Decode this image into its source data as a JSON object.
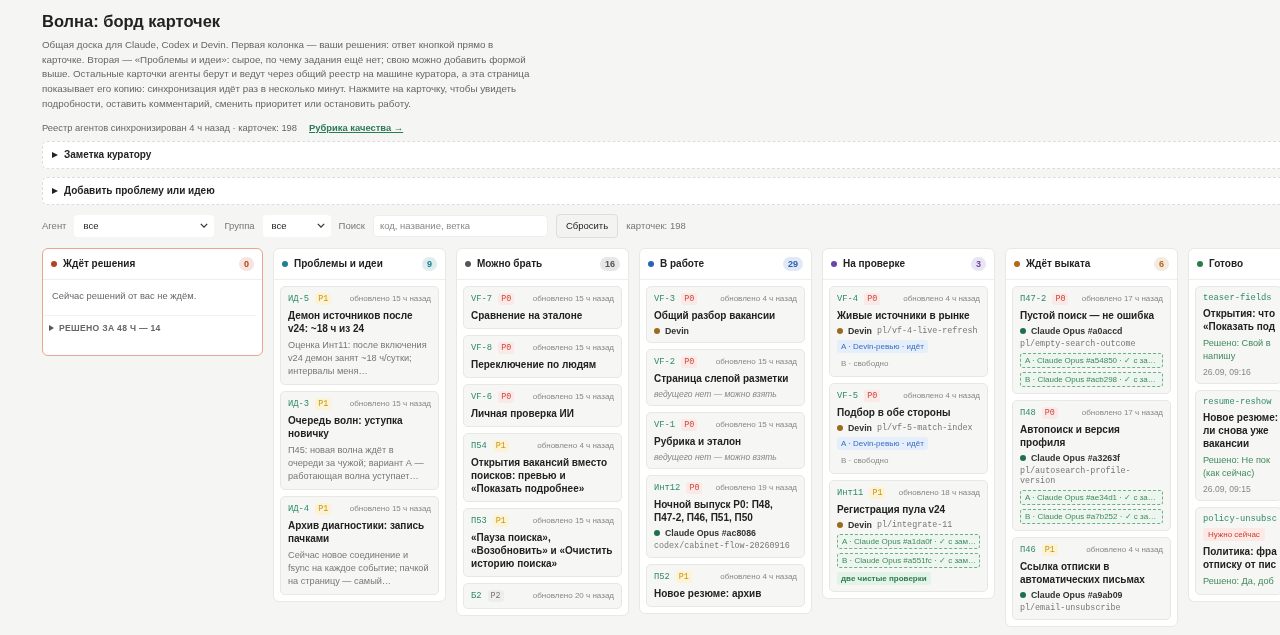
{
  "title": "Волна: борд карточек",
  "intro": "Общая доска для Claude, Codex и Devin. Первая колонка — ваши решения: ответ кнопкой прямо в карточке. Вторая — «Проблемы и идеи»: сырое, по чему задания ещё нет; свою можно добавить формой выше. Остальные карточки агенты берут и ведут через общий реестр на машине куратора, а эта страница показывает его копию: синхронизация идёт раз в несколько минут. Нажмите на карточку, чтобы увидеть подробности, оставить комментарий, сменить приоритет или остановить работу.",
  "meta": {
    "text": "Реестр агентов синхронизирован 4 ч назад · карточек: 198",
    "link": "Рубрика качества →"
  },
  "sections": [
    {
      "label": "Заметка куратору",
      "expanded": false
    },
    {
      "label": "Добавить проблему или идею",
      "expanded": false
    }
  ],
  "filters": {
    "agent_label": "Агент",
    "agent_value": "все",
    "group_label": "Группа",
    "group_value": "все",
    "search_label": "Поиск",
    "search_placeholder": "код, название, ветка",
    "reset": "Сбросить",
    "count": "карточек: 198"
  },
  "columns": [
    {
      "kind": "decisions",
      "title": "Ждёт решения",
      "color": "#b8401e",
      "count": "0",
      "empty": "Сейчас решений от вас не ждём.",
      "resolved": {
        "label": "РЕШЕНО ЗА 48 Ч — 14",
        "expanded": false
      }
    },
    {
      "kind": "board",
      "title": "Проблемы и идеи",
      "color": "#1f7f8e",
      "count": "9",
      "cards": [
        {
          "code": "ИД-5",
          "priority": {
            "label": "P1",
            "kind": "high"
          },
          "updated": "обновлено 15 ч назад",
          "title": "Демон источников после v24: ~18 ч из 24",
          "desc": "Оценка Инт11: после включения v24 демон занят ~18 ч/сутки; интервалы меня…"
        },
        {
          "code": "ИД-3",
          "priority": {
            "label": "P1",
            "kind": "high"
          },
          "updated": "обновлено 15 ч назад",
          "title": "Очередь волн: уступка новичку",
          "desc": "П45: новая волна ждёт в очереди за чужой; вариант А — работающая волна уступает…"
        },
        {
          "code": "ИД-4",
          "priority": {
            "label": "P1",
            "kind": "high"
          },
          "updated": "обновлено 15 ч назад",
          "title": "Архив диагностики: запись пачками",
          "desc": "Сейчас новое соединение и fsync на каждое событие; пачкой на страницу — самый…"
        }
      ]
    },
    {
      "kind": "board",
      "title": "Можно брать",
      "color": "#555555",
      "count": "16",
      "cards": [
        {
          "code": "VF-7",
          "priority": {
            "label": "P0",
            "kind": "urgent"
          },
          "updated": "обновлено 15 ч назад",
          "title": "Сравнение на эталоне"
        },
        {
          "code": "VF-8",
          "priority": {
            "label": "P0",
            "kind": "urgent"
          },
          "updated": "обновлено 15 ч назад",
          "title": "Переключение по людям"
        },
        {
          "code": "VF-6",
          "priority": {
            "label": "P0",
            "kind": "urgent"
          },
          "updated": "обновлено 15 ч назад",
          "title": "Личная проверка ИИ"
        },
        {
          "code": "П54",
          "priority": {
            "label": "P1",
            "kind": "high"
          },
          "updated": "обновлено 4 ч назад",
          "title": "Открытия вакансий вместо поисков: превью и «Показать подробнее»"
        },
        {
          "code": "П53",
          "priority": {
            "label": "P1",
            "kind": "high"
          },
          "updated": "обновлено 15 ч назад",
          "title": "«Пауза поиска», «Возобновить» и «Очистить историю поиска»"
        },
        {
          "code": "Б2",
          "priority": {
            "label": "P2",
            "kind": "low"
          },
          "updated": "обновлено 20 ч назад"
        }
      ]
    },
    {
      "kind": "board",
      "title": "В работе",
      "color": "#2a62b8",
      "count": "29",
      "cards": [
        {
          "code": "VF-3",
          "priority": {
            "label": "P0",
            "kind": "urgent"
          },
          "updated": "обновлено 4 ч назад",
          "title": "Общий разбор вакансии",
          "agent": {
            "name": "Devin",
            "color": "#9a6a1e"
          }
        },
        {
          "code": "VF-2",
          "priority": {
            "label": "P0",
            "kind": "urgent"
          },
          "updated": "обновлено 15 ч назад",
          "title": "Страница слепой разметки",
          "note": "ведущего нет — можно взять"
        },
        {
          "code": "VF-1",
          "priority": {
            "label": "P0",
            "kind": "urgent"
          },
          "updated": "обновлено 15 ч назад",
          "title": "Рубрика и эталон",
          "note": "ведущего нет — можно взять"
        },
        {
          "code": "Инт12",
          "priority": {
            "label": "P0",
            "kind": "urgent"
          },
          "updated": "обновлено 19 ч назад",
          "title": "Ночной выпуск P0: П48, П47-2, П46, П51, П50",
          "agent": {
            "name": "Claude Opus #ac8086",
            "color": "#1f6f4f",
            "branch": "codex/cabinet-flow-20260916"
          }
        },
        {
          "code": "П52",
          "priority": {
            "label": "P1",
            "kind": "high"
          },
          "updated": "обновлено 4 ч назад",
          "title": "Новое резюме: архив"
        }
      ]
    },
    {
      "kind": "board",
      "title": "На проверке",
      "color": "#6a45a8",
      "count": "3",
      "cards": [
        {
          "code": "VF-4",
          "priority": {
            "label": "P0",
            "kind": "urgent"
          },
          "updated": "обновлено 4 ч назад",
          "title": "Живые источники в рынке",
          "agent": {
            "name": "Devin",
            "color": "#9a6a1e",
            "branch": "pl/vf-4-live-refresh"
          },
          "reviews": [
            {
              "kind": "running",
              "text": "A · Devin-ревью · идёт"
            },
            {
              "kind": "free",
              "text": "B · свободно"
            }
          ]
        },
        {
          "code": "VF-5",
          "priority": {
            "label": "P0",
            "kind": "urgent"
          },
          "updated": "обновлено 4 ч назад",
          "title": "Подбор в обе стороны",
          "agent": {
            "name": "Devin",
            "color": "#9a6a1e",
            "branch": "pl/vf-5-match-index"
          },
          "reviews": [
            {
              "kind": "running",
              "text": "A · Devin-ревью · идёт"
            },
            {
              "kind": "free",
              "text": "B · свободно"
            }
          ]
        },
        {
          "code": "Инт11",
          "priority": {
            "label": "P1",
            "kind": "high"
          },
          "updated": "обновлено 18 ч назад",
          "title": "Регистрация пула v24",
          "agent": {
            "name": "Devin",
            "color": "#9a6a1e",
            "branch": "pl/integrate-11"
          },
          "reviews": [
            {
              "kind": "done",
              "text": "A · Claude Opus #a1da0f · ✓ с зам…"
            },
            {
              "kind": "done",
              "text": "B · Claude Opus #a551fc · ✓ с зам…"
            }
          ],
          "verdict": "две чистые проверки"
        }
      ]
    },
    {
      "kind": "board",
      "title": "Ждёт выката",
      "color": "#b2691a",
      "count": "6",
      "cards": [
        {
          "code": "П47-2",
          "priority": {
            "label": "P0",
            "kind": "urgent"
          },
          "updated": "обновлено 17 ч назад",
          "title": "Пустой поиск — не ошибка",
          "agent": {
            "name": "Claude Opus #a0accd",
            "color": "#1f6f4f",
            "branch": "pl/empty-search-outcome"
          },
          "reviews": [
            {
              "kind": "done",
              "text": "A · Claude Opus #a54850 · ✓ с за…"
            },
            {
              "kind": "done",
              "text": "B · Claude Opus #acb298 · ✓ с за…"
            }
          ]
        },
        {
          "code": "П48",
          "priority": {
            "label": "P0",
            "kind": "urgent"
          },
          "updated": "обновлено 17 ч назад",
          "title": "Автопоиск и версия профиля",
          "agent": {
            "name": "Claude Opus #a3263f",
            "color": "#1f6f4f",
            "branch": "pl/autosearch-profile-version"
          },
          "reviews": [
            {
              "kind": "done",
              "text": "A · Claude Opus #ae34d1 · ✓ с за…"
            },
            {
              "kind": "done",
              "text": "B · Claude Opus #a7b252 · ✓ с за…"
            }
          ]
        },
        {
          "code": "П46",
          "priority": {
            "label": "P1",
            "kind": "high"
          },
          "updated": "обновлено 4 ч назад",
          "title": "Ссылка отписки в автоматических письмах",
          "agent": {
            "name": "Claude Opus #a9ab09",
            "color": "#1f6f4f",
            "branch": "pl/email-unsubscribe"
          }
        }
      ]
    },
    {
      "kind": "done",
      "title": "Готово",
      "color": "#2a7d4a",
      "cards": [
        {
          "code": "teaser-fields",
          "title_lines": [
            "Открытия: что",
            "«Показать под"
          ],
          "resolution_lines": [
            "Решено: Свой в",
            "напишу"
          ],
          "date": "26.09, 09:16"
        },
        {
          "code": "resume-reshow",
          "title_lines": [
            "Новое резюме:",
            "ли снова уже",
            "вакансии"
          ],
          "resolution_lines": [
            "Решено: Не пок",
            "(как сейчас)"
          ],
          "date": "26.09, 09:15"
        },
        {
          "code": "policy-unsubsc",
          "flag": "Нужно сейчас",
          "title_lines": [
            "Политика: фра",
            "отписку от пис"
          ],
          "resolution_lines": [
            "Решено: Да, доб"
          ]
        }
      ]
    }
  ]
}
